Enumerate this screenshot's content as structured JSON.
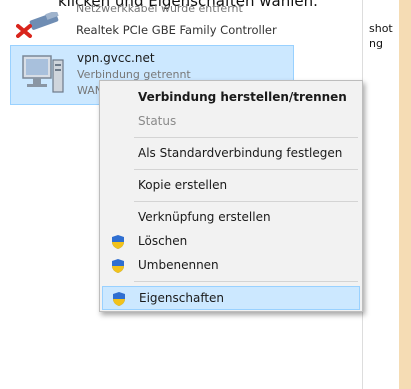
{
  "caption": "klicken und Eigenschaften wählen.",
  "adapter": {
    "status": "Netzwerkkabel wurde entfernt",
    "name": "Realtek PCIe GBE Family Controller"
  },
  "vpn": {
    "name": "vpn.gvcc.net",
    "status": "Verbindung getrennt",
    "type": "WAN"
  },
  "right_panel": {
    "line1": "shot",
    "line2": "ng"
  },
  "context_menu": {
    "items": [
      {
        "label": "Verbindung herstellen/trennen"
      },
      {
        "label": "Status"
      },
      {
        "label": "Als Standardverbindung festlegen"
      },
      {
        "label": "Kopie erstellen"
      },
      {
        "label": "Verknüpfung erstellen"
      },
      {
        "label": "Löschen"
      },
      {
        "label": "Umbenennen"
      },
      {
        "label": "Eigenschaften"
      }
    ]
  },
  "colors": {
    "selection_bg": "#cce8ff",
    "selection_border": "#99d1ff",
    "menu_bg": "#f2f2f2",
    "right_stripe": "#f5dcb4"
  },
  "icons": {
    "adapter": "disconnected-cable-icon",
    "vpn": "computer-network-icon",
    "shield": "uac-shield-icon"
  }
}
